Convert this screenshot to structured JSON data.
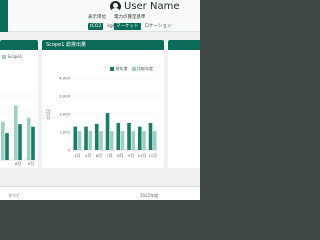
{
  "header": {
    "user_name": "User Name",
    "display_unit": {
      "label": "表示単位",
      "options": [
        "tCO2",
        "kgCO2"
      ],
      "selected": "tCO2"
    },
    "calc_method": {
      "label": "電力の算定基準",
      "options": [
        "マーケット",
        "ロケーション"
      ],
      "selected": "マーケット"
    }
  },
  "left_card": {
    "legend": [
      "Scope1"
    ],
    "x_labels": [
      "",
      "8月",
      "9月"
    ]
  },
  "scope1_card": {
    "title": "Scope1 総排出量",
    "legend": [
      "前年度",
      "比較年度"
    ],
    "y_label": "tCO2",
    "y_ticks": [
      "4,000",
      "3,000",
      "2,000",
      "1,000",
      "0"
    ]
  },
  "bottom": {
    "left_text": "すべて",
    "right_text": "2022年度"
  },
  "colors": {
    "accent": "#0b6b58",
    "series_dark": "#1a7d68",
    "series_light": "#9fcfc1"
  },
  "chart_data": [
    {
      "type": "bar",
      "title": "Scope1 総排出量",
      "ylabel": "tCO2",
      "ylim": [
        0,
        4000
      ],
      "categories": [
        "4月",
        "5月",
        "6月",
        "7月",
        "8月",
        "9月",
        "10月",
        "11月"
      ],
      "series": [
        {
          "name": "前年度",
          "values": [
            1300,
            1300,
            1450,
            2050,
            1500,
            1500,
            1300,
            1500
          ]
        },
        {
          "name": "比較年度",
          "values": [
            1050,
            1050,
            1050,
            1050,
            1050,
            1050,
            1050,
            1050
          ]
        }
      ],
      "grid": true,
      "legend": "top-right"
    },
    {
      "type": "bar",
      "ylim": [
        0,
        100
      ],
      "categories": [
        "7月",
        "8月",
        "9月"
      ],
      "series": [
        {
          "name": "Scope1",
          "values": [
            60,
            85,
            66
          ]
        },
        {
          "values": [
            42,
            56,
            52
          ]
        }
      ],
      "legend": "top-right"
    }
  ]
}
